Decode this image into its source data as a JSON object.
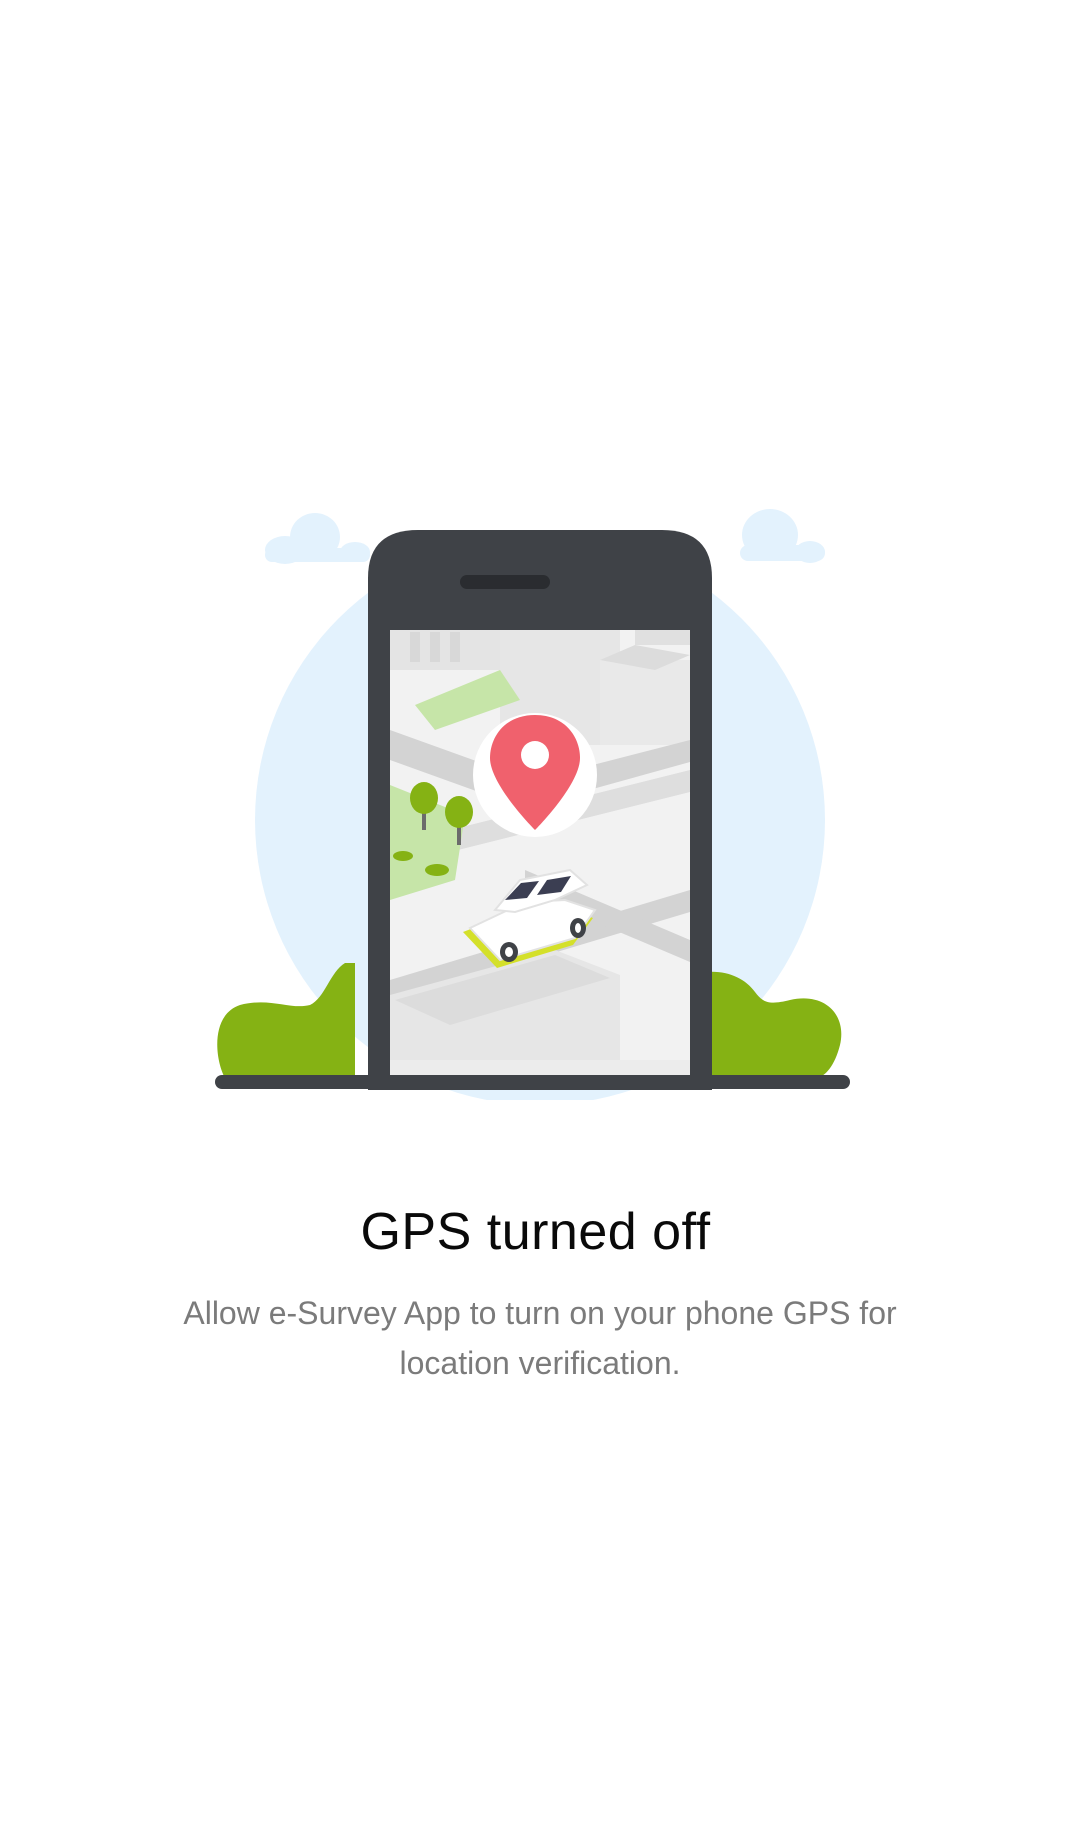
{
  "screen": {
    "title": "GPS turned off",
    "message": "Allow e-Survey App to turn on your phone GPS for location verification."
  },
  "illustration": {
    "icons": [
      "cloud-icon",
      "phone-icon",
      "map-icon",
      "location-pin-icon",
      "car-icon",
      "tree-icon",
      "bush-icon"
    ],
    "colors": {
      "sky": "#e3f2fd",
      "phone_body": "#3f4247",
      "bush": "#85b214",
      "pin": "#f0616d",
      "map_background": "#f2f2f2",
      "park": "#c6e5a8",
      "car_accent": "#d4e02a"
    }
  }
}
